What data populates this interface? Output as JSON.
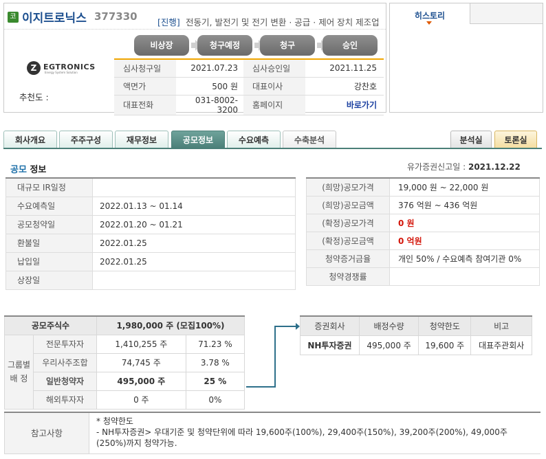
{
  "company": {
    "badge": "코",
    "name": "이지트로닉스",
    "code": "377330",
    "status": "[진행]",
    "description": "전동기, 발전기 및 전기 변환 · 공급 · 제어 장치 제조업",
    "logo_text": "EGTRONICS",
    "logo_subtext": "Energy System Solution",
    "recommend_label": "추천도 :"
  },
  "steps": [
    "비상장",
    "청구예정",
    "청구",
    "승인"
  ],
  "info": {
    "rows": [
      {
        "label1": "심사청구일",
        "value1": "2021.07.23",
        "label2": "심사승인일",
        "value2": "2021.11.25"
      },
      {
        "label1": "액면가",
        "value1": "500 원",
        "label2": "대표이사",
        "value2": "강찬호"
      },
      {
        "label1": "대표전화",
        "value1": "031-8002-3200",
        "label2": "홈페이지",
        "value2": "바로가기"
      }
    ]
  },
  "history": {
    "tab_label": "히스토리"
  },
  "tabs": [
    {
      "label": "회사개요",
      "state": "normal"
    },
    {
      "label": "주주구성",
      "state": "normal"
    },
    {
      "label": "재무정보",
      "state": "normal"
    },
    {
      "label": "공모정보",
      "state": "active"
    },
    {
      "label": "수요예측",
      "state": "normal"
    },
    {
      "label": "수축분석",
      "state": "gray"
    },
    {
      "label": "분석실",
      "state": "analysis"
    },
    {
      "label": "토론실",
      "state": "discussion"
    }
  ],
  "section": {
    "title_hl": "공모",
    "title_rest": " 정보",
    "filing_label": "유가증권신고일 :",
    "filing_date": "2021.12.22"
  },
  "schedule_left": [
    {
      "label": "대규모 IR일정",
      "value": ""
    },
    {
      "label": "수요예측일",
      "value": "2022.01.13 ~ 01.14"
    },
    {
      "label": "공모청약일",
      "value": "2022.01.20 ~ 01.21"
    },
    {
      "label": "환불일",
      "value": "2022.01.25"
    },
    {
      "label": "납입일",
      "value": "2022.01.25"
    },
    {
      "label": "상장일",
      "value": ""
    }
  ],
  "schedule_right": [
    {
      "label": "(희망)공모가격",
      "value": "19,000 원 ~ 22,000 원",
      "red": false
    },
    {
      "label": "(희망)공모금액",
      "value": "376 억원  ~ 436 억원",
      "red": false
    },
    {
      "label": "(확정)공모가격",
      "value": "0 원",
      "red": true
    },
    {
      "label": "(확정)공모금액",
      "value": "0 억원",
      "red": true
    },
    {
      "label": "청약증거금율",
      "value": "개인 50% / 수요예측 참여기관 0%",
      "red": false
    },
    {
      "label": "청약경쟁률",
      "value": "",
      "red": false
    }
  ],
  "shares": {
    "header_label": "공모주식수",
    "header_value": "1,980,000  주 (모집100%)",
    "group_label": "그룹별 배 정",
    "rows": [
      {
        "label": "전문투자자",
        "shares": "1,410,255 주",
        "pct": "71.23 %"
      },
      {
        "label": "우리사주조합",
        "shares": "74,745 주",
        "pct": "3.78 %"
      },
      {
        "label": "일반청약자",
        "shares": "495,000  주",
        "pct": "25 %"
      },
      {
        "label": "해외투자자",
        "shares": "0 주",
        "pct": "0%"
      }
    ]
  },
  "underwriter": {
    "headers": [
      "증권회사",
      "배정수량",
      "청약한도",
      "비고"
    ],
    "row": {
      "firm": "NH투자증권",
      "qty": "495,000 주",
      "limit": "19,600 주",
      "note": "대표주관회사"
    }
  },
  "notes": {
    "label": "참고사항",
    "line1": "* 청약한도",
    "line2": "- NH투자증권> 우대기준 및 청약단위에 따라 19,600주(100%), 29,400주(150%), 39,200주(200%), 49,000주(250%)까지 청약가능."
  }
}
